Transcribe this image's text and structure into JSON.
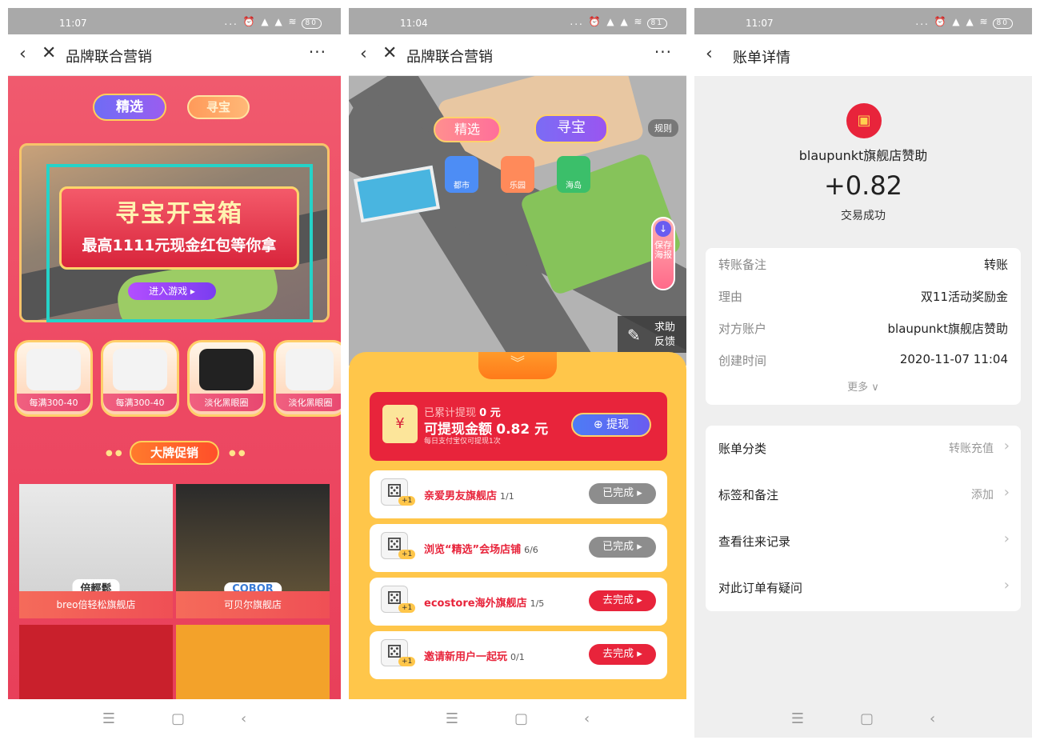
{
  "status_bars": [
    {
      "time": "11:07",
      "battery": "80"
    },
    {
      "time": "11:04",
      "battery": "81"
    },
    {
      "time": "11:07",
      "battery": "80"
    }
  ],
  "status_icons": "... ⏰ ▲ ▲ ≋",
  "screen1": {
    "title": "品牌联合营销",
    "tabs": [
      "精选",
      "寻宝"
    ],
    "banner": {
      "line1": "寻宝开宝箱",
      "line2": "最高1111元现金红包等你拿",
      "enter": "进入游戏 ▸"
    },
    "products": [
      "每满300-40",
      "每满300-40",
      "淡化黑眼圈",
      "淡化黑眼圈"
    ],
    "promo_label": "大牌促销",
    "stores": [
      {
        "brand": "倍輕鬆",
        "caption": "breo倍轻松旗舰店"
      },
      {
        "brand": "COBOR",
        "caption": "可贝尔旗舰店"
      }
    ]
  },
  "screen2": {
    "title": "品牌联合营销",
    "tabs": [
      "精选",
      "寻宝"
    ],
    "rules": "规则",
    "locations": [
      "都市",
      "乐园",
      "海岛"
    ],
    "save_poster": "保存海报",
    "help": [
      "求助",
      "反馈"
    ],
    "cash": {
      "withdrawn_label": "已累计提现",
      "withdrawn_value": "0 元",
      "available_label": "可提现金额",
      "available_value": "0.82 元",
      "note": "每日支付宝仅可提现1次",
      "button": "提现"
    },
    "tasks": [
      {
        "name": "亲爱男友旗舰店",
        "count": "1/1",
        "status": "已完成 ▸",
        "done": true
      },
      {
        "name": "浏览“精选”会场店铺",
        "count": "6/6",
        "status": "已完成 ▸",
        "done": true
      },
      {
        "name": "ecostore海外旗舰店",
        "count": "1/5",
        "status": "去完成 ▸",
        "done": false
      },
      {
        "name": "邀请新用户一起玩",
        "count": "0/1",
        "status": "去完成 ▸",
        "done": false
      }
    ],
    "dice_bonus": "+1"
  },
  "screen3": {
    "title": "账单详情",
    "shop": "blaupunkt旗舰店赞助",
    "amount": "+0.82",
    "state": "交易成功",
    "details": [
      {
        "k": "转账备注",
        "v": "转账"
      },
      {
        "k": "理由",
        "v": "双11活动奖励金"
      },
      {
        "k": "对方账户",
        "v": "blaupunkt旗舰店赞助"
      },
      {
        "k": "创建时间",
        "v": "2020-11-07 11:04"
      }
    ],
    "more": "更多 ∨",
    "options": [
      {
        "k": "账单分类",
        "v": "转账充值"
      },
      {
        "k": "标签和备注",
        "v": "添加"
      }
    ],
    "links": [
      "查看往来记录",
      "对此订单有疑问"
    ]
  }
}
